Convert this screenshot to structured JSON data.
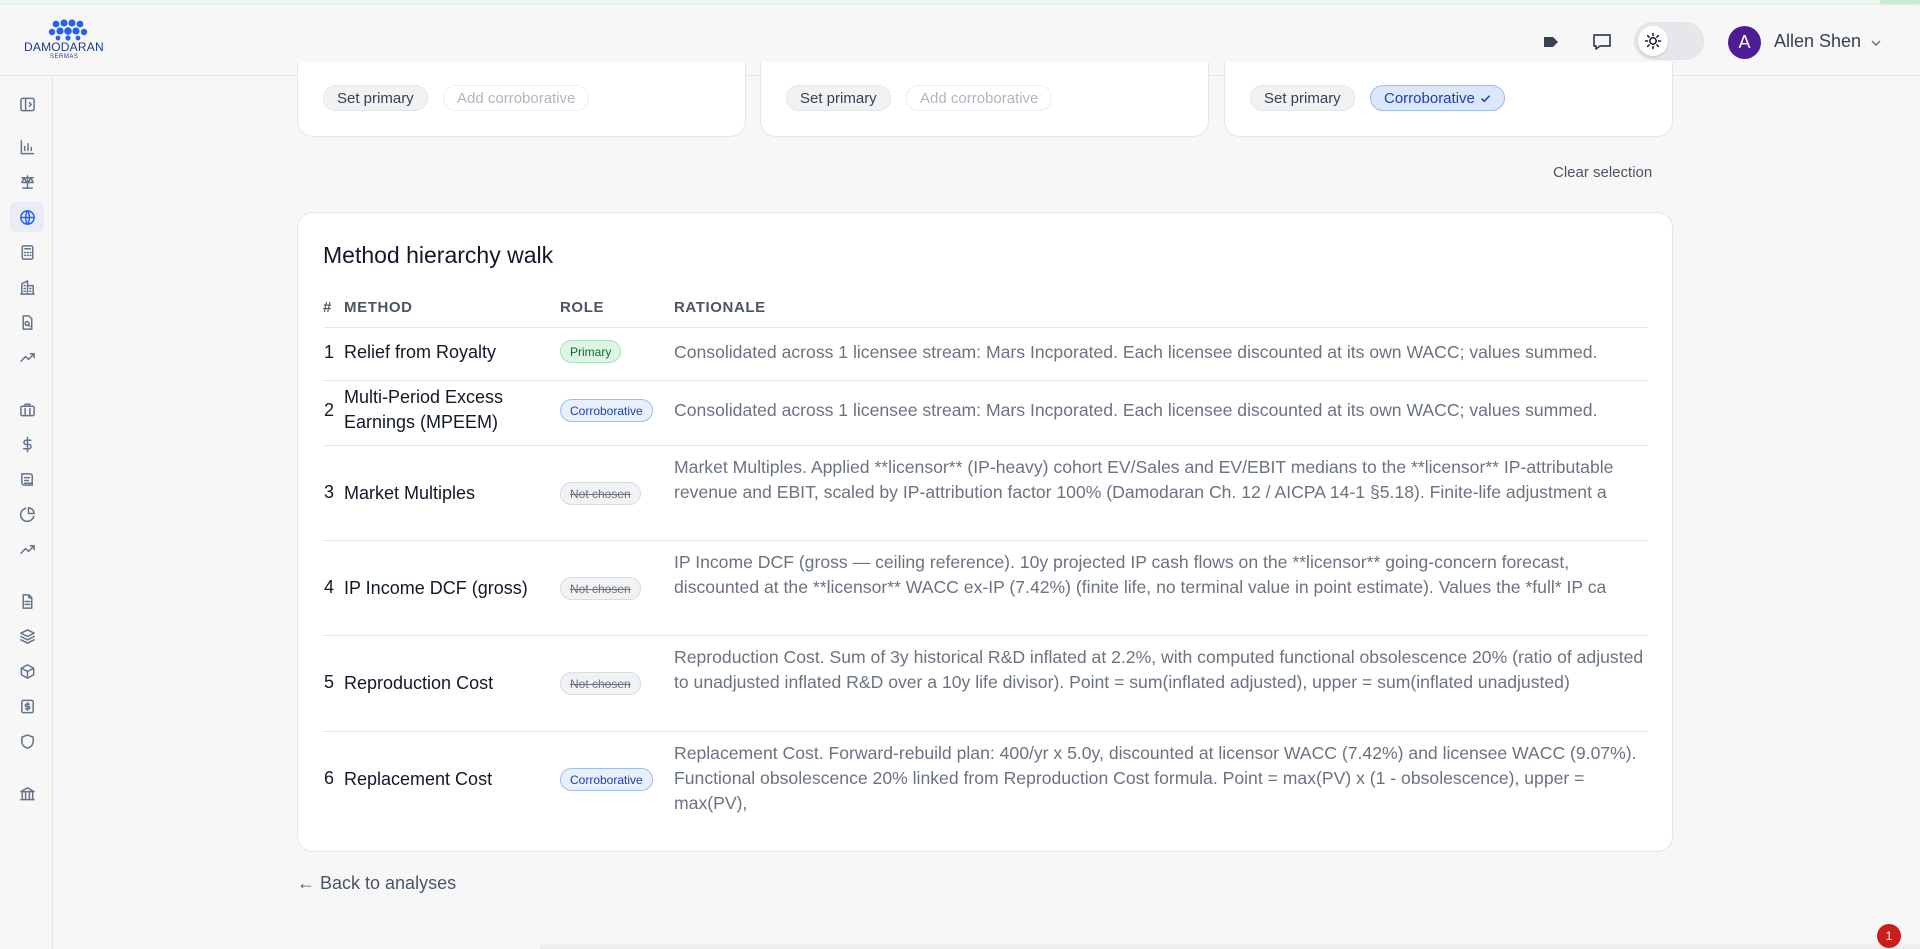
{
  "brand": {
    "name": "DAMODARAN",
    "sub": "SERMAS"
  },
  "header": {
    "user_initial": "A",
    "user_name": "Allen Shen"
  },
  "sidebar": {
    "icons": [
      "panel-toggle-icon",
      "bar-chart-icon",
      "scale-icon",
      "globe-icon",
      "calculator-icon",
      "building-icon",
      "file-search-icon",
      "trending-up-icon",
      "briefcase-icon",
      "dollar-icon",
      "ledger-icon",
      "pie-chart-icon",
      "trend-line-icon",
      "document-icon",
      "layers-icon",
      "package-icon",
      "receipt-icon",
      "shield-icon",
      "bank-icon"
    ],
    "active": "globe-icon"
  },
  "method_cards": [
    {
      "set_primary": "Set primary",
      "second_chip": "Add corroborative",
      "second_state": "add"
    },
    {
      "set_primary": "Set primary",
      "second_chip": "Add corroborative",
      "second_state": "add"
    },
    {
      "set_primary": "Set primary",
      "second_chip": "Corroborative",
      "second_state": "active"
    }
  ],
  "clear_selection": "Clear selection",
  "hierarchy": {
    "title": "Method hierarchy walk",
    "columns": {
      "num": "#",
      "method": "METHOD",
      "role": "ROLE",
      "rationale": "RATIONALE"
    },
    "rows": [
      {
        "num": "1",
        "method": "Relief from Royalty",
        "role": "Primary",
        "role_type": "primary",
        "rationale": "Consolidated across 1 licensee stream: Mars Incporated. Each licensee discounted at its own WACC; values summed."
      },
      {
        "num": "2",
        "method": "Multi-Period Excess Earnings (MPEEM)",
        "role": "Corroborative",
        "role_type": "corrob",
        "rationale": "Consolidated across 1 licensee stream: Mars Incporated. Each licensee discounted at its own WACC; values summed."
      },
      {
        "num": "3",
        "method": "Market Multiples",
        "role": "Not chosen",
        "role_type": "notchosen",
        "rationale": "Market Multiples. Applied **licensor** (IP-heavy) cohort EV/Sales and EV/EBIT medians to the **licensor** IP-attributable revenue and EBIT, scaled by IP-attribution factor 100% (Damodaran Ch. 12 / AICPA 14-1 §5.18). Finite-life adjustment a"
      },
      {
        "num": "4",
        "method": "IP Income DCF (gross)",
        "role": "Not chosen",
        "role_type": "notchosen",
        "rationale": "IP Income DCF (gross — ceiling reference). 10y projected IP cash flows on the **licensor** going-concern forecast, discounted at the **licensor** WACC ex-IP (7.42%) (finite life, no terminal value in point estimate). Values the *full* IP ca"
      },
      {
        "num": "5",
        "method": "Reproduction Cost",
        "role": "Not chosen",
        "role_type": "notchosen",
        "rationale": "Reproduction Cost. Sum of 3y historical R&D inflated at 2.2%, with computed functional obsolescence 20% (ratio of adjusted to unadjusted inflated R&D over a 10y life divisor). Point = sum(inflated adjusted), upper = sum(inflated unadjusted)"
      },
      {
        "num": "6",
        "method": "Replacement Cost",
        "role": "Corroborative",
        "role_type": "corrob",
        "rationale": "Replacement Cost. Forward-rebuild plan: 400/yr x 5.0y, discounted at licensor WACC (7.42%) and licensee WACC (9.07%). Functional obsolescence 20% linked from Reproduction Cost formula. Point = max(PV) x (1 - obsolescence), upper = max(PV),"
      }
    ]
  },
  "back_link": "← Back to analyses",
  "notification_count": "1"
}
